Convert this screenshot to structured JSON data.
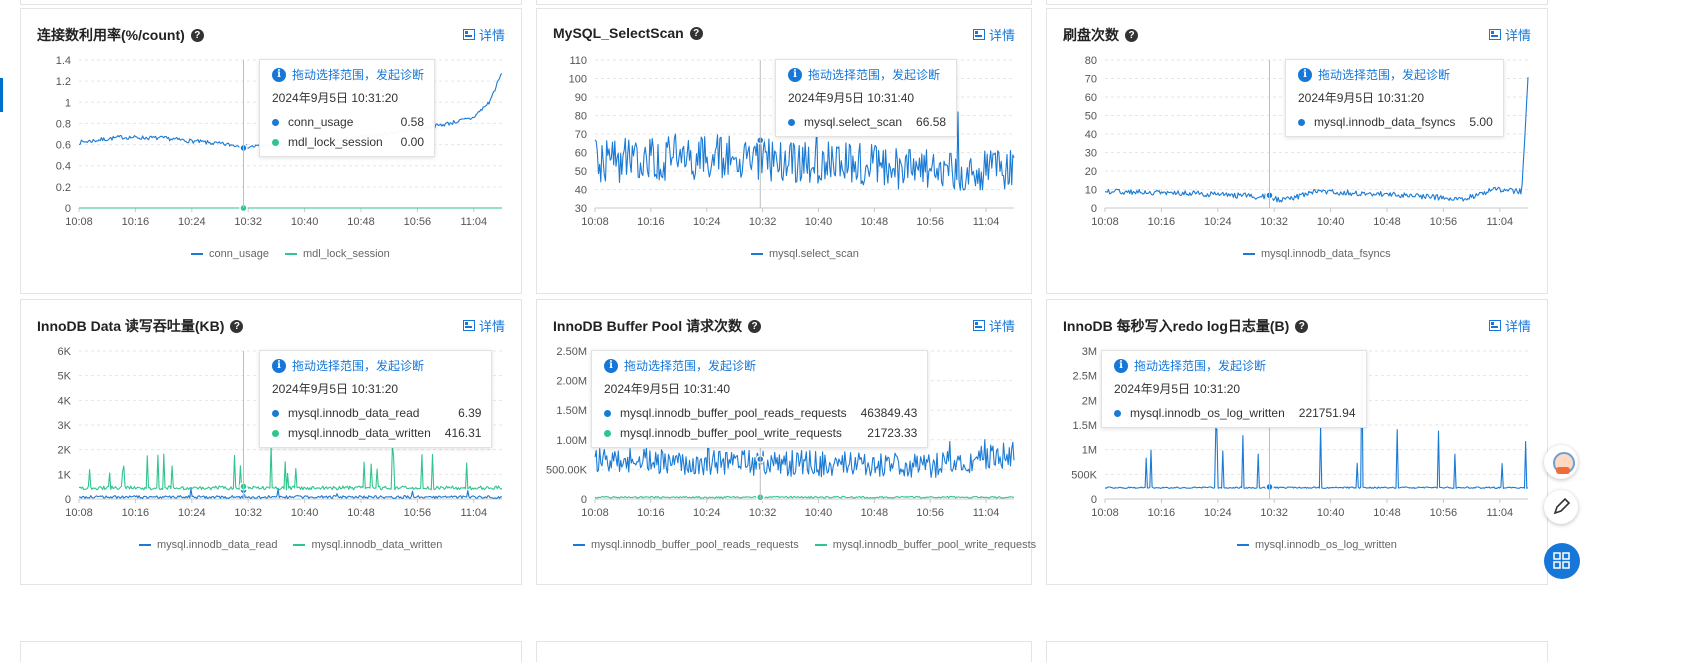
{
  "colors": {
    "blue": "#1a7ad4",
    "green": "#2fc58c",
    "link": "#1677d9"
  },
  "common": {
    "detail_label": "详情",
    "tooltip_hint": "拖动选择范围，发起诊断",
    "x_ticks": [
      "10:08",
      "10:16",
      "10:24",
      "10:32",
      "10:40",
      "10:48",
      "10:56",
      "11:04"
    ]
  },
  "panels": [
    {
      "title": "连接数利用率(%/count)",
      "tooltip_time": "2024年9月5日 10:31:20",
      "tooltip_rows": [
        {
          "label": "conn_usage",
          "value": "0.58"
        },
        {
          "label": "mdl_lock_session",
          "value": "0.00"
        }
      ],
      "legend": [
        "conn_usage",
        "mdl_lock_session"
      ],
      "chart_data": {
        "type": "line",
        "x_range": [
          "10:08",
          "11:08"
        ],
        "y_ticks": [
          "0",
          "0.2",
          "0.4",
          "0.6",
          "0.8",
          "1",
          "1.2",
          "1.4"
        ],
        "ylim": [
          0,
          1.4
        ],
        "cursor_time": "10:31:20",
        "series": [
          {
            "name": "conn_usage",
            "color": "blue",
            "noise": 0.02,
            "spikes": 0,
            "profile": [
              [
                0,
                0.62
              ],
              [
                0.1,
                0.67
              ],
              [
                0.2,
                0.66
              ],
              [
                0.3,
                0.62
              ],
              [
                0.35,
                0.6
              ],
              [
                0.4,
                0.58
              ],
              [
                0.45,
                0.59
              ],
              [
                0.55,
                0.62
              ],
              [
                0.65,
                0.66
              ],
              [
                0.75,
                0.72
              ],
              [
                0.85,
                0.78
              ],
              [
                0.93,
                0.85
              ],
              [
                0.97,
                1.0
              ],
              [
                1,
                1.28
              ]
            ]
          },
          {
            "name": "mdl_lock_session",
            "color": "green",
            "noise": 0,
            "spikes": 0,
            "profile": [
              [
                0,
                0
              ],
              [
                1,
                0
              ]
            ]
          }
        ]
      }
    },
    {
      "title": "MySQL_SelectScan",
      "tooltip_time": "2024年9月5日 10:31:40",
      "tooltip_rows": [
        {
          "label": "mysql.select_scan",
          "value": "66.58"
        }
      ],
      "legend": [
        "mysql.select_scan"
      ],
      "chart_data": {
        "type": "line",
        "x_range": [
          "10:08",
          "11:08"
        ],
        "y_ticks": [
          "30",
          "40",
          "50",
          "60",
          "70",
          "80",
          "90",
          "100",
          "110"
        ],
        "ylim": [
          30,
          110
        ],
        "cursor_time": "10:31:40",
        "series": [
          {
            "name": "mysql.select_scan",
            "color": "blue",
            "noise": 12,
            "spikes": 4,
            "profile": [
              [
                0,
                55
              ],
              [
                0.3,
                58
              ],
              [
                0.5,
                55
              ],
              [
                0.7,
                52
              ],
              [
                1,
                50
              ]
            ]
          }
        ]
      }
    },
    {
      "title": "刷盘次数",
      "tooltip_time": "2024年9月5日 10:31:20",
      "tooltip_rows": [
        {
          "label": "mysql.innodb_data_fsyncs",
          "value": "5.00"
        }
      ],
      "legend": [
        "mysql.innodb_data_fsyncs"
      ],
      "chart_data": {
        "type": "line",
        "x_range": [
          "10:08",
          "11:08"
        ],
        "y_ticks": [
          "0",
          "10",
          "20",
          "30",
          "40",
          "50",
          "60",
          "70",
          "80"
        ],
        "ylim": [
          0,
          80
        ],
        "cursor_time": "10:31:20",
        "series": [
          {
            "name": "mysql.innodb_data_fsyncs",
            "color": "blue",
            "noise": 1.5,
            "spikes": 0,
            "profile": [
              [
                0,
                9
              ],
              [
                0.2,
                8
              ],
              [
                0.38,
                6
              ],
              [
                0.42,
                4
              ],
              [
                0.5,
                9
              ],
              [
                0.7,
                7
              ],
              [
                0.85,
                5
              ],
              [
                0.92,
                10
              ],
              [
                0.985,
                9
              ],
              [
                1,
                70
              ]
            ]
          }
        ]
      }
    },
    {
      "title": "InnoDB Data 读写吞吐量(KB)",
      "tooltip_time": "2024年9月5日 10:31:20",
      "tooltip_rows": [
        {
          "label": "mysql.innodb_data_read",
          "value": "6.39"
        },
        {
          "label": "mysql.innodb_data_written",
          "value": "416.31"
        }
      ],
      "legend": [
        "mysql.innodb_data_read",
        "mysql.innodb_data_written"
      ],
      "chart_data": {
        "type": "line",
        "x_range": [
          "10:08",
          "11:08"
        ],
        "y_ticks": [
          "0",
          "1K",
          "2K",
          "3K",
          "4K",
          "5K",
          "6K"
        ],
        "ylim": [
          0,
          6000
        ],
        "cursor_time": "10:31:20",
        "series": [
          {
            "name": "mysql.innodb_data_read",
            "color": "blue",
            "noise": 60,
            "spikes": 6,
            "spike_height": 350,
            "profile": [
              [
                0,
                80
              ],
              [
                1,
                80
              ]
            ]
          },
          {
            "name": "mysql.innodb_data_written",
            "color": "green",
            "noise": 80,
            "spikes": 22,
            "spike_height": 1600,
            "profile": [
              [
                0,
                450
              ],
              [
                1,
                450
              ]
            ]
          }
        ]
      }
    },
    {
      "title": "InnoDB Buffer Pool 请求次数",
      "tooltip_time": "2024年9月5日 10:31:40",
      "tooltip_rows": [
        {
          "label": "mysql.innodb_buffer_pool_reads_requests",
          "value": "463849.43"
        },
        {
          "label": "mysql.innodb_buffer_pool_write_requests",
          "value": "21723.33"
        }
      ],
      "legend": [
        "mysql.innodb_buffer_pool_reads_requests",
        "mysql.innodb_buffer_pool_write_requests"
      ],
      "chart_data": {
        "type": "line",
        "x_range": [
          "10:08",
          "11:08"
        ],
        "y_ticks": [
          "0",
          "500.00K",
          "1.00M",
          "1.50M",
          "2.00M",
          "2.50M"
        ],
        "ylim": [
          0,
          2500000
        ],
        "cursor_time": "10:31:40",
        "series": [
          {
            "name": "mysql.innodb_buffer_pool_reads_requests",
            "color": "blue",
            "noise": 220000,
            "spikes": 4,
            "spike_height": 400000,
            "profile": [
              [
                0,
                650000
              ],
              [
                0.5,
                600000
              ],
              [
                0.8,
                550000
              ],
              [
                1,
                750000
              ]
            ]
          },
          {
            "name": "mysql.innodb_buffer_pool_write_requests",
            "color": "green",
            "noise": 15000,
            "spikes": 0,
            "profile": [
              [
                0,
                30000
              ],
              [
                1,
                30000
              ]
            ]
          }
        ]
      }
    },
    {
      "title": "InnoDB 每秒写入redo log日志量(B)",
      "tooltip_time": "2024年9月5日 10:31:20",
      "tooltip_rows": [
        {
          "label": "mysql.innodb_os_log_written",
          "value": "221751.94"
        }
      ],
      "legend": [
        "mysql.innodb_os_log_written"
      ],
      "chart_data": {
        "type": "line",
        "x_range": [
          "10:08",
          "11:08"
        ],
        "y_ticks": [
          "0",
          "500K",
          "1M",
          "1.5M",
          "2M",
          "2.5M",
          "3M"
        ],
        "ylim": [
          0,
          3000000
        ],
        "cursor_time": "10:31:20",
        "series": [
          {
            "name": "mysql.innodb_os_log_written",
            "color": "blue",
            "noise": 15000,
            "spikes": 16,
            "spike_height": 1300000,
            "profile": [
              [
                0,
                230000
              ],
              [
                1,
                230000
              ]
            ]
          }
        ]
      }
    }
  ]
}
